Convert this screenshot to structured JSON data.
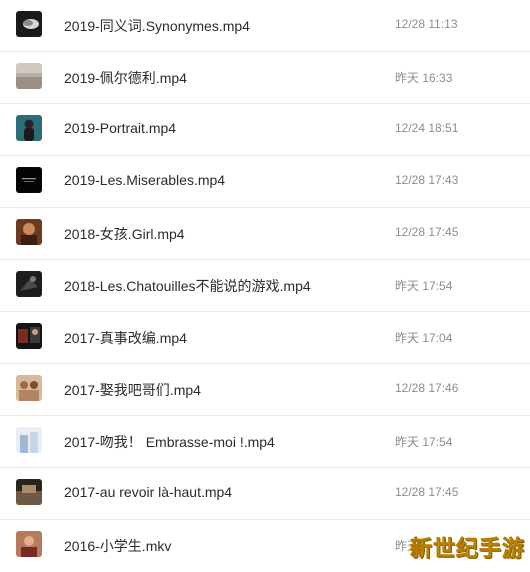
{
  "files": [
    {
      "name": "2019-同义词.Synonymes.mp4",
      "time": "12/28 11:13",
      "thumb": "thumbnail-image"
    },
    {
      "name": "2019-佩尔德利.mp4",
      "time": "昨天 16:33",
      "thumb": "thumbnail-image"
    },
    {
      "name": "2019-Portrait.mp4",
      "time": "12/24 18:51",
      "thumb": "thumbnail-image"
    },
    {
      "name": "2019-Les.Miserables.mp4",
      "time": "12/28 17:43",
      "thumb": "thumbnail-image"
    },
    {
      "name": "2018-女孩.Girl.mp4",
      "time": "12/28 17:45",
      "thumb": "thumbnail-image"
    },
    {
      "name": "2018-Les.Chatouilles不能说的游戏.mp4",
      "time": "昨天 17:54",
      "thumb": "thumbnail-image"
    },
    {
      "name": "2017-真事改编.mp4",
      "time": "昨天 17:04",
      "thumb": "thumbnail-image"
    },
    {
      "name": "2017-娶我吧哥们.mp4",
      "time": "12/28 17:46",
      "thumb": "thumbnail-image"
    },
    {
      "name": "2017-吻我！ Embrasse-moi !.mp4",
      "time": "昨天 17:54",
      "thumb": "thumbnail-image"
    },
    {
      "name": "2017-au revoir là-haut.mp4",
      "time": "12/28 17:45",
      "thumb": "thumbnail-image"
    },
    {
      "name": "2016-小学生.mkv",
      "time": "昨天",
      "thumb": "thumbnail-image"
    }
  ],
  "watermark": "新世纪手游",
  "colors": {
    "text": "#2b2b2b",
    "time": "#8c8c8c",
    "divider": "#ececec",
    "watermark": "#f5c518"
  }
}
